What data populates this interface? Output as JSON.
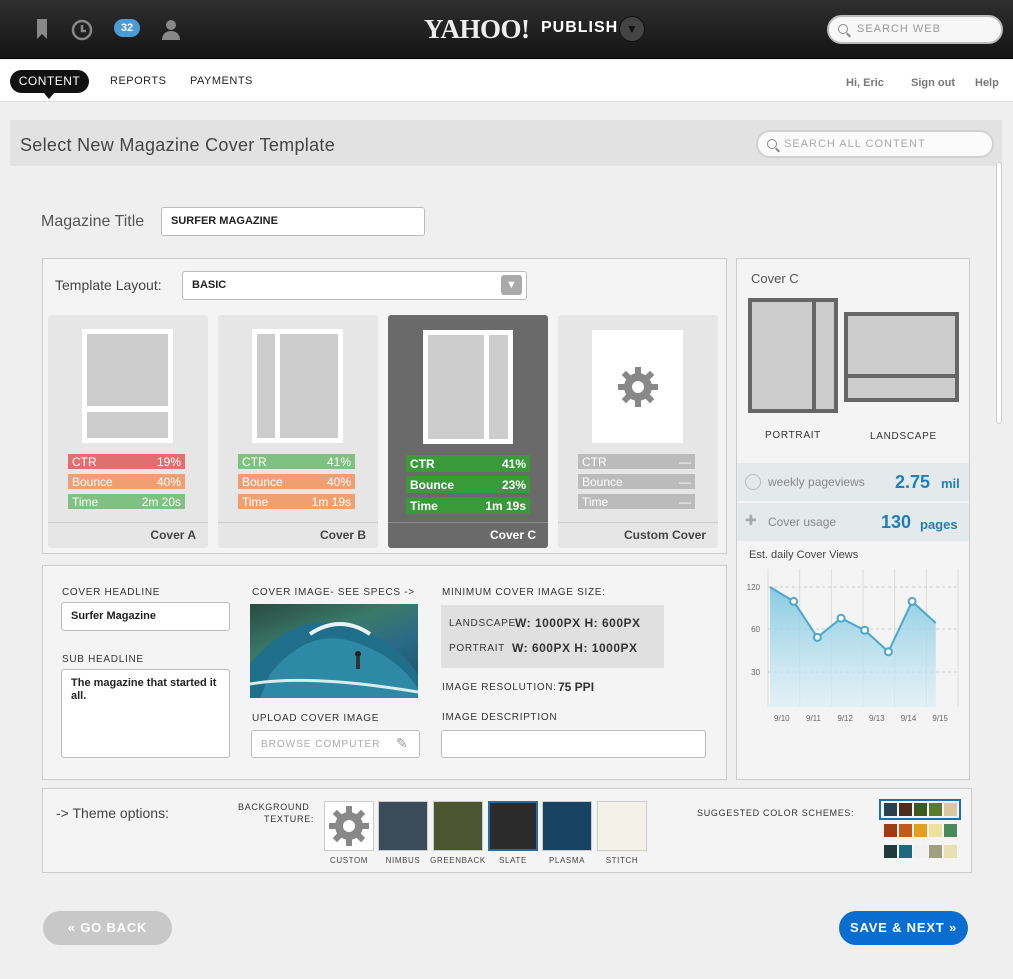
{
  "topbar": {
    "badge_count": "32",
    "logo": "YAHOO!",
    "publish": "PUBLISH",
    "search_placeholder": "SEARCH WEB"
  },
  "nav": {
    "tabs": [
      {
        "label": "CONTENT",
        "active": true
      },
      {
        "label": "REPORTS"
      },
      {
        "label": "PAYMENTS"
      }
    ],
    "greeting": "Hi, Eric",
    "sign_out": "Sign out",
    "help": "Help"
  },
  "header": {
    "title": "Select New Magazine Cover Template",
    "search_placeholder": "SEARCH ALL CONTENT"
  },
  "form": {
    "magazine_title_label": "Magazine Title",
    "magazine_title_value": "SURFER MAGAZINE",
    "template_layout_label": "Template Layout:",
    "template_layout_value": "BASIC"
  },
  "covers": [
    {
      "name": "Cover A",
      "metrics": [
        {
          "label": "CTR",
          "value": "19%"
        },
        {
          "label": "Bounce",
          "value": "40%"
        },
        {
          "label": "Time",
          "value": "2m 20s"
        }
      ]
    },
    {
      "name": "Cover B",
      "metrics": [
        {
          "label": "CTR",
          "value": "41%"
        },
        {
          "label": "Bounce",
          "value": "40%"
        },
        {
          "label": "Time",
          "value": "1m 19s"
        }
      ]
    },
    {
      "name": "Cover C",
      "metrics": [
        {
          "label": "CTR",
          "value": "41%"
        },
        {
          "label": "Bounce",
          "value": "23%"
        },
        {
          "label": "Time",
          "value": "1m 19s"
        }
      ]
    },
    {
      "name": "Custom Cover",
      "metrics": [
        {
          "label": "CTR",
          "value": "—"
        },
        {
          "label": "Bounce",
          "value": "—"
        },
        {
          "label": "Time",
          "value": "—"
        }
      ]
    }
  ],
  "details": {
    "headline_label": "COVER HEADLINE",
    "headline_value": "Surfer Magazine",
    "sub_label": "SUB HEADLINE",
    "sub_value": "The magazine that started it all.",
    "image_label": "COVER IMAGE- SEE SPECS ->",
    "upload_label": "UPLOAD COVER IMAGE",
    "browse_label": "BROWSE COMPUTER",
    "min_size_label": "MINIMUM COVER IMAGE SIZE:",
    "landscape_label": "LANDSCAPE",
    "landscape_size": "W: 1000PX  H: 600PX",
    "portrait_label": "PORTRAIT",
    "portrait_size": "W: 600PX  H: 1000PX",
    "resolution_label": "IMAGE RESOLUTION:",
    "resolution_value": "75 PPI",
    "description_label": "IMAGE DESCRIPTION"
  },
  "sidebar": {
    "title": "Cover C",
    "portrait": "PORTRAIT",
    "landscape": "LANDSCAPE",
    "pageviews_label": "weekly pageviews",
    "pageviews_value": "2.75",
    "pageviews_unit": "mil",
    "usage_label": "Cover usage",
    "usage_value": "130",
    "usage_unit": "pages",
    "chart_title": "Est. daily Cover Views"
  },
  "chart_data": {
    "type": "area",
    "title": "Est. daily Cover Views",
    "x": [
      "9/10",
      "9/11",
      "9/12",
      "9/13",
      "9/14",
      "9/15"
    ],
    "y_ticks": [
      "120",
      "60",
      "30"
    ],
    "values": [
      [
        0,
        100
      ],
      [
        1,
        88
      ],
      [
        2,
        58
      ],
      [
        3,
        74
      ],
      [
        4,
        64
      ],
      [
        5,
        46
      ],
      [
        6,
        88
      ],
      [
        7,
        70
      ]
    ],
    "point_indices": [
      1,
      2,
      3,
      4,
      5,
      6
    ],
    "color": "#7cc6e0"
  },
  "theme": {
    "label": "-> Theme options:",
    "bg_label_1": "BACKGROUND",
    "bg_label_2": "TEXTURE:",
    "textures": [
      {
        "name": "CUSTOM",
        "color": "#fff"
      },
      {
        "name": "NIMBUS",
        "color": "#3c4b5a"
      },
      {
        "name": "GREENBACK",
        "color": "#4b5530"
      },
      {
        "name": "SLATE",
        "color": "#2b2b2b"
      },
      {
        "name": "PLASMA",
        "color": "#174262"
      },
      {
        "name": "STITCH",
        "color": "#f4f2e8"
      }
    ],
    "schemes_label": "SUGGESTED COLOR SCHEMES:",
    "schemes": [
      [
        "#2c3e50",
        "#4a2e1e",
        "#3a5a1e",
        "#5a7a2e",
        "#d8c8a0"
      ],
      [
        "#a03a10",
        "#c05a1a",
        "#e0a020",
        "#f0e0a0",
        "#4a8a5a"
      ],
      [
        "#1e3a3a",
        "#1e6a7a",
        "#f0f0f0",
        "#a0a080",
        "#e8e0b0"
      ]
    ]
  },
  "buttons": {
    "back": "« GO BACK",
    "next": "SAVE & NEXT »"
  },
  "colors": {
    "accent": "#1e7fb8",
    "ctr_red": "#e07070",
    "bounce_orange": "#f0a070",
    "time_green": "#80c080",
    "sel_green": "#3a9a3a",
    "save_blue": "#0a6ed1"
  }
}
